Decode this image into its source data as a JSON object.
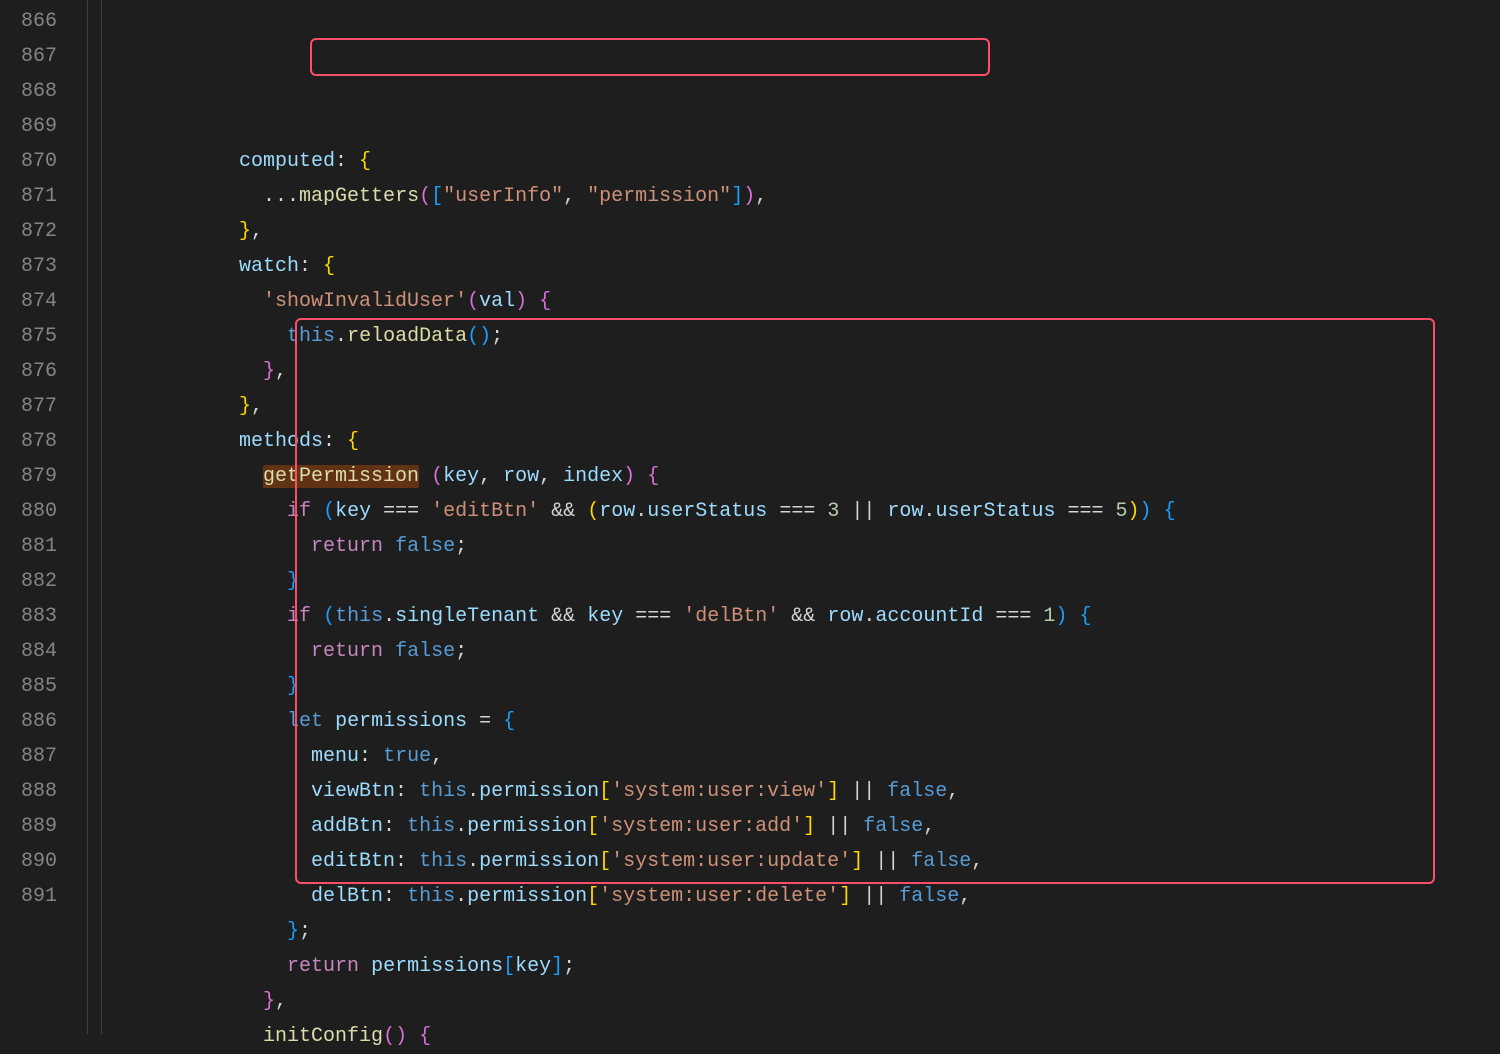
{
  "lineStart": 866,
  "lineCount": 26,
  "highlightWord": "getPermission",
  "annotations": {
    "box1": {
      "desc": "mapGetters call highlight"
    },
    "box2": {
      "desc": "getPermission method highlight"
    }
  },
  "code": {
    "l866": {
      "indent": 3,
      "t": [
        {
          "c": "prp",
          "v": "computed"
        },
        {
          "c": "p",
          "v": ": "
        },
        {
          "c": "br-y",
          "v": "{"
        }
      ]
    },
    "l867": {
      "indent": 4,
      "t": [
        {
          "c": "p",
          "v": "..."
        },
        {
          "c": "fn",
          "v": "mapGetters"
        },
        {
          "c": "br-p",
          "v": "("
        },
        {
          "c": "br-b",
          "v": "["
        },
        {
          "c": "str",
          "v": "\"userInfo\""
        },
        {
          "c": "p",
          "v": ", "
        },
        {
          "c": "str",
          "v": "\"permission\""
        },
        {
          "c": "br-b",
          "v": "]"
        },
        {
          "c": "br-p",
          "v": ")"
        },
        {
          "c": "p",
          "v": ","
        }
      ]
    },
    "l868": {
      "indent": 3,
      "t": [
        {
          "c": "br-y",
          "v": "}"
        },
        {
          "c": "p",
          "v": ","
        }
      ]
    },
    "l869": {
      "indent": 3,
      "t": [
        {
          "c": "prp",
          "v": "watch"
        },
        {
          "c": "p",
          "v": ": "
        },
        {
          "c": "br-y",
          "v": "{"
        }
      ]
    },
    "l870": {
      "indent": 4,
      "t": [
        {
          "c": "str",
          "v": "'showInvalidUser'"
        },
        {
          "c": "br-p",
          "v": "("
        },
        {
          "c": "prm",
          "v": "val"
        },
        {
          "c": "br-p",
          "v": ")"
        },
        {
          "c": "p",
          "v": " "
        },
        {
          "c": "br-p",
          "v": "{"
        }
      ]
    },
    "l871": {
      "indent": 5,
      "t": [
        {
          "c": "kw",
          "v": "this"
        },
        {
          "c": "p",
          "v": "."
        },
        {
          "c": "fn",
          "v": "reloadData"
        },
        {
          "c": "br-b",
          "v": "("
        },
        {
          "c": "br-b",
          "v": ")"
        },
        {
          "c": "p",
          "v": ";"
        }
      ]
    },
    "l872": {
      "indent": 4,
      "t": [
        {
          "c": "br-p",
          "v": "}"
        },
        {
          "c": "p",
          "v": ","
        }
      ]
    },
    "l873": {
      "indent": 3,
      "t": [
        {
          "c": "br-y",
          "v": "}"
        },
        {
          "c": "p",
          "v": ","
        }
      ]
    },
    "l874": {
      "indent": 3,
      "t": [
        {
          "c": "prp",
          "v": "methods"
        },
        {
          "c": "p",
          "v": ": "
        },
        {
          "c": "br-y",
          "v": "{"
        }
      ]
    },
    "l875": {
      "indent": 4,
      "t": [
        {
          "c": "fn hl-bg",
          "v": "getPermission"
        },
        {
          "c": "p",
          "v": " "
        },
        {
          "c": "br-p",
          "v": "("
        },
        {
          "c": "prm",
          "v": "key"
        },
        {
          "c": "p",
          "v": ", "
        },
        {
          "c": "prm",
          "v": "row"
        },
        {
          "c": "p",
          "v": ", "
        },
        {
          "c": "prm",
          "v": "index"
        },
        {
          "c": "br-p",
          "v": ")"
        },
        {
          "c": "p",
          "v": " "
        },
        {
          "c": "br-p",
          "v": "{"
        }
      ]
    },
    "l876": {
      "indent": 5,
      "t": [
        {
          "c": "kw2",
          "v": "if"
        },
        {
          "c": "p",
          "v": " "
        },
        {
          "c": "br-b",
          "v": "("
        },
        {
          "c": "prm",
          "v": "key"
        },
        {
          "c": "p",
          "v": " "
        },
        {
          "c": "op",
          "v": "==="
        },
        {
          "c": "p",
          "v": " "
        },
        {
          "c": "str",
          "v": "'editBtn'"
        },
        {
          "c": "p",
          "v": " "
        },
        {
          "c": "op",
          "v": "&&"
        },
        {
          "c": "p",
          "v": " "
        },
        {
          "c": "br-y",
          "v": "("
        },
        {
          "c": "prm",
          "v": "row"
        },
        {
          "c": "p",
          "v": "."
        },
        {
          "c": "prp",
          "v": "userStatus"
        },
        {
          "c": "p",
          "v": " "
        },
        {
          "c": "op",
          "v": "==="
        },
        {
          "c": "p",
          "v": " "
        },
        {
          "c": "num",
          "v": "3"
        },
        {
          "c": "p",
          "v": " "
        },
        {
          "c": "op",
          "v": "||"
        },
        {
          "c": "p",
          "v": " "
        },
        {
          "c": "prm",
          "v": "row"
        },
        {
          "c": "p",
          "v": "."
        },
        {
          "c": "prp",
          "v": "userStatus"
        },
        {
          "c": "p",
          "v": " "
        },
        {
          "c": "op",
          "v": "==="
        },
        {
          "c": "p",
          "v": " "
        },
        {
          "c": "num",
          "v": "5"
        },
        {
          "c": "br-y",
          "v": ")"
        },
        {
          "c": "br-b",
          "v": ")"
        },
        {
          "c": "p",
          "v": " "
        },
        {
          "c": "br-b",
          "v": "{"
        }
      ]
    },
    "l877": {
      "indent": 6,
      "t": [
        {
          "c": "kw2",
          "v": "return"
        },
        {
          "c": "p",
          "v": " "
        },
        {
          "c": "bl",
          "v": "false"
        },
        {
          "c": "p",
          "v": ";"
        }
      ]
    },
    "l878": {
      "indent": 5,
      "t": [
        {
          "c": "br-b",
          "v": "}"
        }
      ]
    },
    "l879": {
      "indent": 5,
      "t": [
        {
          "c": "kw2",
          "v": "if"
        },
        {
          "c": "p",
          "v": " "
        },
        {
          "c": "br-b",
          "v": "("
        },
        {
          "c": "kw",
          "v": "this"
        },
        {
          "c": "p",
          "v": "."
        },
        {
          "c": "prp",
          "v": "singleTenant"
        },
        {
          "c": "p",
          "v": " "
        },
        {
          "c": "op",
          "v": "&&"
        },
        {
          "c": "p",
          "v": " "
        },
        {
          "c": "prm",
          "v": "key"
        },
        {
          "c": "p",
          "v": " "
        },
        {
          "c": "op",
          "v": "==="
        },
        {
          "c": "p",
          "v": " "
        },
        {
          "c": "str",
          "v": "'delBtn'"
        },
        {
          "c": "p",
          "v": " "
        },
        {
          "c": "op",
          "v": "&&"
        },
        {
          "c": "p",
          "v": " "
        },
        {
          "c": "prm",
          "v": "row"
        },
        {
          "c": "p",
          "v": "."
        },
        {
          "c": "prp",
          "v": "accountId"
        },
        {
          "c": "p",
          "v": " "
        },
        {
          "c": "op",
          "v": "==="
        },
        {
          "c": "p",
          "v": " "
        },
        {
          "c": "num",
          "v": "1"
        },
        {
          "c": "br-b",
          "v": ")"
        },
        {
          "c": "p",
          "v": " "
        },
        {
          "c": "br-b",
          "v": "{"
        }
      ]
    },
    "l880": {
      "indent": 6,
      "t": [
        {
          "c": "kw2",
          "v": "return"
        },
        {
          "c": "p",
          "v": " "
        },
        {
          "c": "bl",
          "v": "false"
        },
        {
          "c": "p",
          "v": ";"
        }
      ]
    },
    "l881": {
      "indent": 5,
      "t": [
        {
          "c": "br-b",
          "v": "}"
        }
      ]
    },
    "l882": {
      "indent": 5,
      "t": [
        {
          "c": "kw",
          "v": "let"
        },
        {
          "c": "p",
          "v": " "
        },
        {
          "c": "prm",
          "v": "permissions"
        },
        {
          "c": "p",
          "v": " "
        },
        {
          "c": "op",
          "v": "="
        },
        {
          "c": "p",
          "v": " "
        },
        {
          "c": "br-b",
          "v": "{"
        }
      ]
    },
    "l883": {
      "indent": 6,
      "t": [
        {
          "c": "prp",
          "v": "menu"
        },
        {
          "c": "p",
          "v": ": "
        },
        {
          "c": "bl",
          "v": "true"
        },
        {
          "c": "p",
          "v": ","
        }
      ]
    },
    "l884": {
      "indent": 6,
      "t": [
        {
          "c": "prp",
          "v": "viewBtn"
        },
        {
          "c": "p",
          "v": ": "
        },
        {
          "c": "kw",
          "v": "this"
        },
        {
          "c": "p",
          "v": "."
        },
        {
          "c": "prp",
          "v": "permission"
        },
        {
          "c": "br-y",
          "v": "["
        },
        {
          "c": "str",
          "v": "'system:user:view'"
        },
        {
          "c": "br-y",
          "v": "]"
        },
        {
          "c": "p",
          "v": " "
        },
        {
          "c": "op",
          "v": "||"
        },
        {
          "c": "p",
          "v": " "
        },
        {
          "c": "bl",
          "v": "false"
        },
        {
          "c": "p",
          "v": ","
        }
      ]
    },
    "l885": {
      "indent": 6,
      "t": [
        {
          "c": "prp",
          "v": "addBtn"
        },
        {
          "c": "p",
          "v": ": "
        },
        {
          "c": "kw",
          "v": "this"
        },
        {
          "c": "p",
          "v": "."
        },
        {
          "c": "prp",
          "v": "permission"
        },
        {
          "c": "br-y",
          "v": "["
        },
        {
          "c": "str",
          "v": "'system:user:add'"
        },
        {
          "c": "br-y",
          "v": "]"
        },
        {
          "c": "p",
          "v": " "
        },
        {
          "c": "op",
          "v": "||"
        },
        {
          "c": "p",
          "v": " "
        },
        {
          "c": "bl",
          "v": "false"
        },
        {
          "c": "p",
          "v": ","
        }
      ]
    },
    "l886": {
      "indent": 6,
      "t": [
        {
          "c": "prp",
          "v": "editBtn"
        },
        {
          "c": "p",
          "v": ": "
        },
        {
          "c": "kw",
          "v": "this"
        },
        {
          "c": "p",
          "v": "."
        },
        {
          "c": "prp",
          "v": "permission"
        },
        {
          "c": "br-y",
          "v": "["
        },
        {
          "c": "str",
          "v": "'system:user:update'"
        },
        {
          "c": "br-y",
          "v": "]"
        },
        {
          "c": "p",
          "v": " "
        },
        {
          "c": "op",
          "v": "||"
        },
        {
          "c": "p",
          "v": " "
        },
        {
          "c": "bl",
          "v": "false"
        },
        {
          "c": "p",
          "v": ","
        }
      ]
    },
    "l887": {
      "indent": 6,
      "t": [
        {
          "c": "prp",
          "v": "delBtn"
        },
        {
          "c": "p",
          "v": ": "
        },
        {
          "c": "kw",
          "v": "this"
        },
        {
          "c": "p",
          "v": "."
        },
        {
          "c": "prp",
          "v": "permission"
        },
        {
          "c": "br-y",
          "v": "["
        },
        {
          "c": "str",
          "v": "'system:user:delete'"
        },
        {
          "c": "br-y",
          "v": "]"
        },
        {
          "c": "p",
          "v": " "
        },
        {
          "c": "op",
          "v": "||"
        },
        {
          "c": "p",
          "v": " "
        },
        {
          "c": "bl",
          "v": "false"
        },
        {
          "c": "p",
          "v": ","
        }
      ]
    },
    "l888": {
      "indent": 5,
      "t": [
        {
          "c": "br-b",
          "v": "}"
        },
        {
          "c": "p",
          "v": ";"
        }
      ]
    },
    "l889": {
      "indent": 5,
      "t": [
        {
          "c": "kw2",
          "v": "return"
        },
        {
          "c": "p",
          "v": " "
        },
        {
          "c": "prm",
          "v": "permissions"
        },
        {
          "c": "br-b",
          "v": "["
        },
        {
          "c": "prm",
          "v": "key"
        },
        {
          "c": "br-b",
          "v": "]"
        },
        {
          "c": "p",
          "v": ";"
        }
      ]
    },
    "l890": {
      "indent": 4,
      "t": [
        {
          "c": "br-p",
          "v": "}"
        },
        {
          "c": "p",
          "v": ","
        }
      ]
    },
    "l891": {
      "indent": 4,
      "t": [
        {
          "c": "fn",
          "v": "initConfig"
        },
        {
          "c": "br-p",
          "v": "("
        },
        {
          "c": "br-p",
          "v": ")"
        },
        {
          "c": "p",
          "v": " "
        },
        {
          "c": "br-p",
          "v": "{"
        }
      ]
    }
  }
}
